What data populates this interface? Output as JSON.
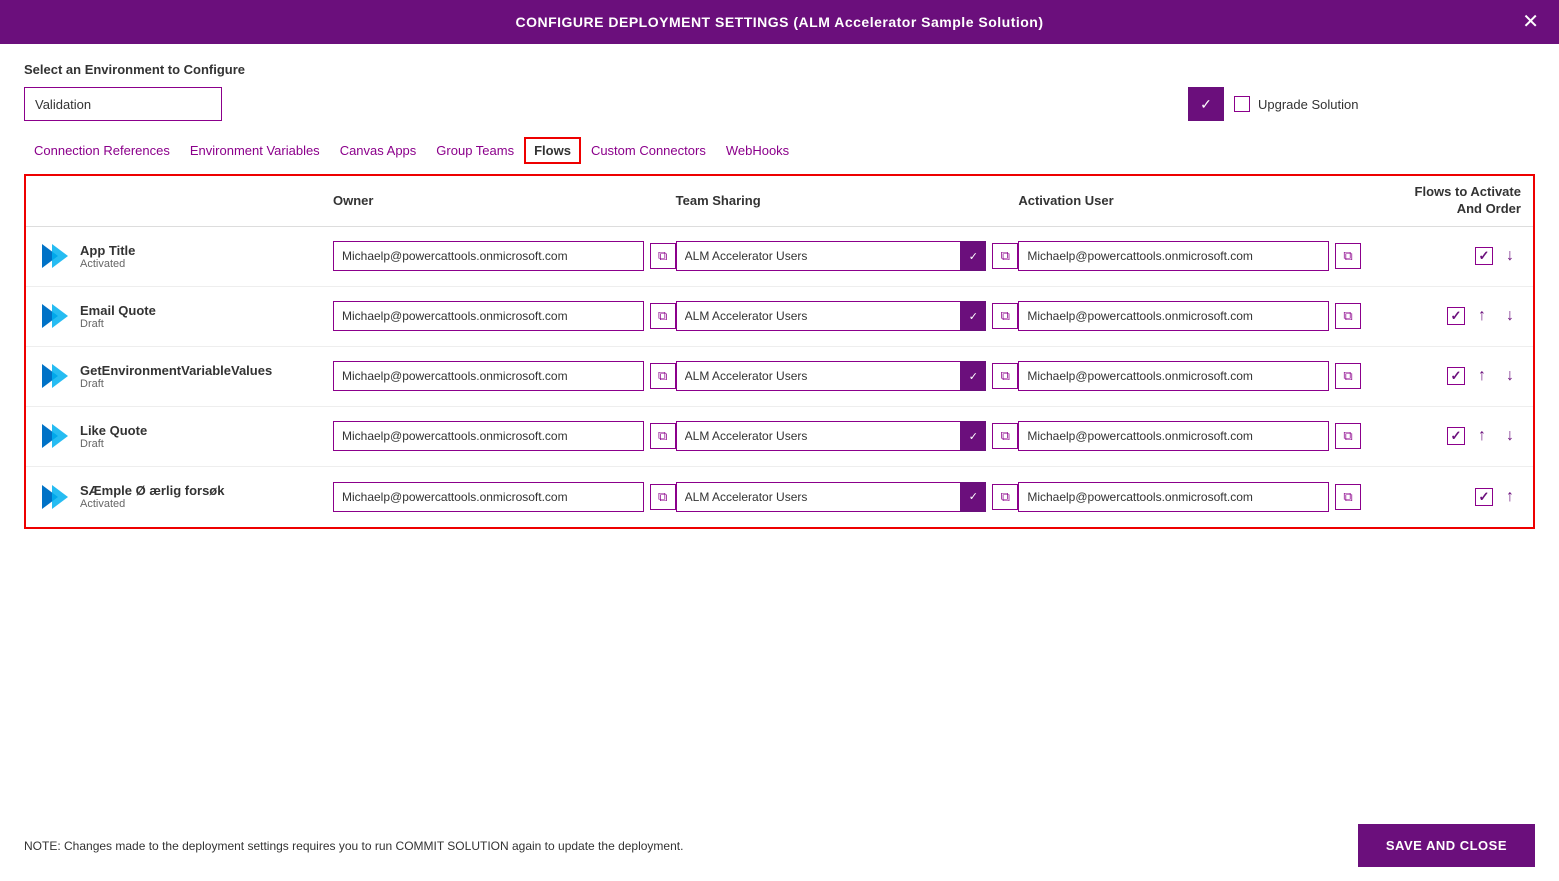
{
  "titleBar": {
    "title": "CONFIGURE DEPLOYMENT SETTINGS (ALM Accelerator Sample Solution)",
    "closeLabel": "✕"
  },
  "envSection": {
    "label": "Select an Environment to Configure",
    "currentEnv": "Validation",
    "caretSymbol": "✓",
    "upgradeLabel": "Upgrade Solution"
  },
  "tabs": [
    {
      "id": "connection-references",
      "label": "Connection References",
      "active": false
    },
    {
      "id": "environment-variables",
      "label": "Environment Variables",
      "active": false
    },
    {
      "id": "canvas-apps",
      "label": "Canvas Apps",
      "active": false
    },
    {
      "id": "group-teams",
      "label": "Group Teams",
      "active": false
    },
    {
      "id": "flows",
      "label": "Flows",
      "active": true
    },
    {
      "id": "custom-connectors",
      "label": "Custom Connectors",
      "active": false
    },
    {
      "id": "webhooks",
      "label": "WebHooks",
      "active": false
    }
  ],
  "table": {
    "headers": {
      "col1": "",
      "owner": "Owner",
      "teamSharing": "Team Sharing",
      "activationUser": "Activation User",
      "flowsOrder": "Flows to Activate\nAnd Order"
    },
    "rows": [
      {
        "name": "App Title",
        "status": "Activated",
        "owner": "Michaelp@powercattools.onmicrosoft.com",
        "teamSharing": "ALM Accelerator Users",
        "activationUser": "Michaelp@powercattools.onmicrosoft.com",
        "checked": true,
        "hasUp": false,
        "hasDown": true
      },
      {
        "name": "Email Quote",
        "status": "Draft",
        "owner": "Michaelp@powercattools.onmicrosoft.com",
        "teamSharing": "ALM Accelerator Users",
        "activationUser": "Michaelp@powercattools.onmicrosoft.com",
        "checked": true,
        "hasUp": true,
        "hasDown": true
      },
      {
        "name": "GetEnvironmentVariableValues",
        "status": "Draft",
        "owner": "Michaelp@powercattools.onmicrosoft.com",
        "teamSharing": "ALM Accelerator Users",
        "activationUser": "Michaelp@powercattools.onmicrosoft.com",
        "checked": true,
        "hasUp": true,
        "hasDown": true
      },
      {
        "name": "Like Quote",
        "status": "Draft",
        "owner": "Michaelp@powercattools.onmicrosoft.com",
        "teamSharing": "ALM Accelerator Users",
        "activationUser": "Michaelp@powercattools.onmicrosoft.com",
        "checked": true,
        "hasUp": true,
        "hasDown": true
      },
      {
        "name": "SÆmple Ø ærlig forsøk",
        "status": "Activated",
        "owner": "Michaelp@powercattools.onmicrosoft.com",
        "teamSharing": "ALM Accelerator Users",
        "activationUser": "Michaelp@powercattools.onmicrosoft.com",
        "checked": true,
        "hasUp": true,
        "hasDown": false
      }
    ]
  },
  "footer": {
    "note": "NOTE: Changes made to the deployment settings requires you to run COMMIT SOLUTION again to update the deployment.",
    "saveClose": "SAVE AND CLOSE"
  }
}
